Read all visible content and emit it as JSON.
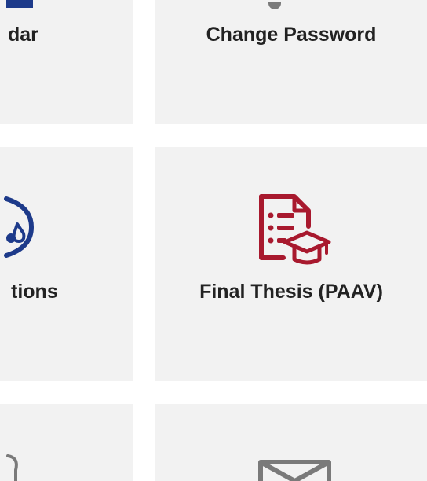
{
  "tiles": {
    "calendar": {
      "label": "dar",
      "icon": "calendar-icon"
    },
    "change_password": {
      "label": "Change Password",
      "icon": "key-icon"
    },
    "notifications": {
      "label": "tions",
      "icon": "settings-icon"
    },
    "final_thesis": {
      "label": "Final Thesis (PAAV)",
      "icon": "document-graduation-cap-icon"
    },
    "bottom_left": {
      "label": "",
      "icon": "partial-icon"
    },
    "messages": {
      "label": "",
      "icon": "envelope-icon"
    }
  },
  "colors": {
    "tile_bg": "#f2f2f2",
    "accent_blue": "#1d3a8a",
    "accent_red": "#a8192e",
    "icon_gray": "#7a7a7a",
    "label_text": "#222222"
  }
}
